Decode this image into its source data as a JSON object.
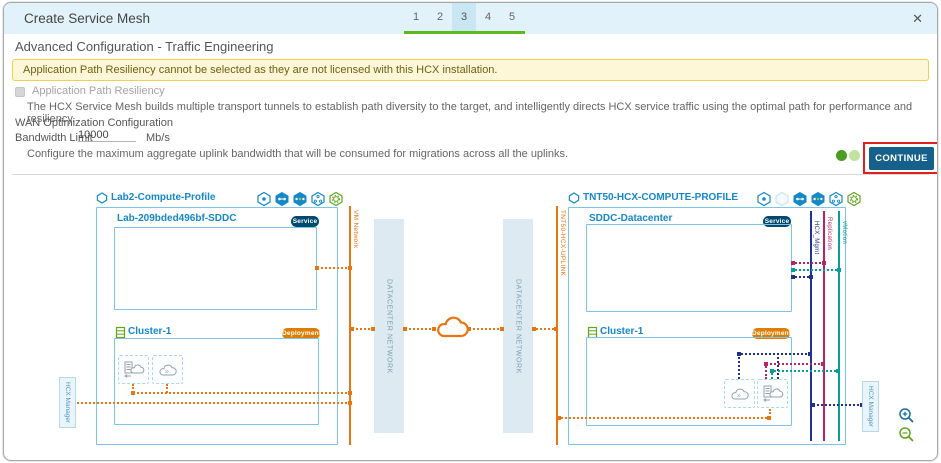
{
  "dialog": {
    "title": "Create Service Mesh",
    "close_icon": "✕",
    "steps": [
      "1",
      "2",
      "3",
      "4",
      "5"
    ],
    "active_step": "3"
  },
  "form": {
    "heading": "Advanced Configuration - Traffic Engineering",
    "warning": "Application Path Resiliency cannot be selected as they are not licensed with this HCX installation.",
    "resiliency": {
      "label": "Application Path Resiliency",
      "description": "The HCX Service Mesh builds multiple transport tunnels to establish path diversity to the target, and intelligently directs HCX service traffic using the optimal path for performance and resiliency."
    },
    "wan": {
      "title": "WAN Optimization Configuration",
      "bandwidth_label": "Bandwidth Limit",
      "bandwidth_value": "10000",
      "bandwidth_unit": "Mb/s",
      "description": "Configure the maximum aggregate uplink bandwidth that will be consumed for migrations across all the uplinks."
    },
    "continue_label": "CONTINUE"
  },
  "diagram": {
    "source": {
      "profile": "Lab2-Compute-Profile",
      "sddc": "Lab-209bded496bf-SDDC",
      "service_badge": "Service",
      "cluster": "Cluster-1",
      "deployment_badge": "Deployment",
      "network": "VM Network",
      "manager": "HCX Manager"
    },
    "target": {
      "profile": "TNT50-HCX-COMPUTE-PROFILE",
      "sddc": "SDDC-Datacenter",
      "service_badge": "Service",
      "cluster": "Cluster-1",
      "deployment_badge": "Deployment",
      "uplink": "TNT50-HCX-UPLINK",
      "manager": "HCX Manager",
      "networks": [
        "HCX_Mgmt",
        "Replication",
        "vMotion"
      ]
    },
    "datacenter_network": "DATACENTER NETWORK"
  },
  "colors": {
    "primary_blue": "#0079B8",
    "button_blue": "#16618C",
    "step_green": "#5CB81B",
    "orange": "#E87511",
    "navy": "#1F3191",
    "crimson": "#B72364",
    "teal": "#089E96",
    "warning_bg": "#FDF6D7",
    "warning_border": "#EFD053",
    "annotation_red": "#E02020"
  }
}
